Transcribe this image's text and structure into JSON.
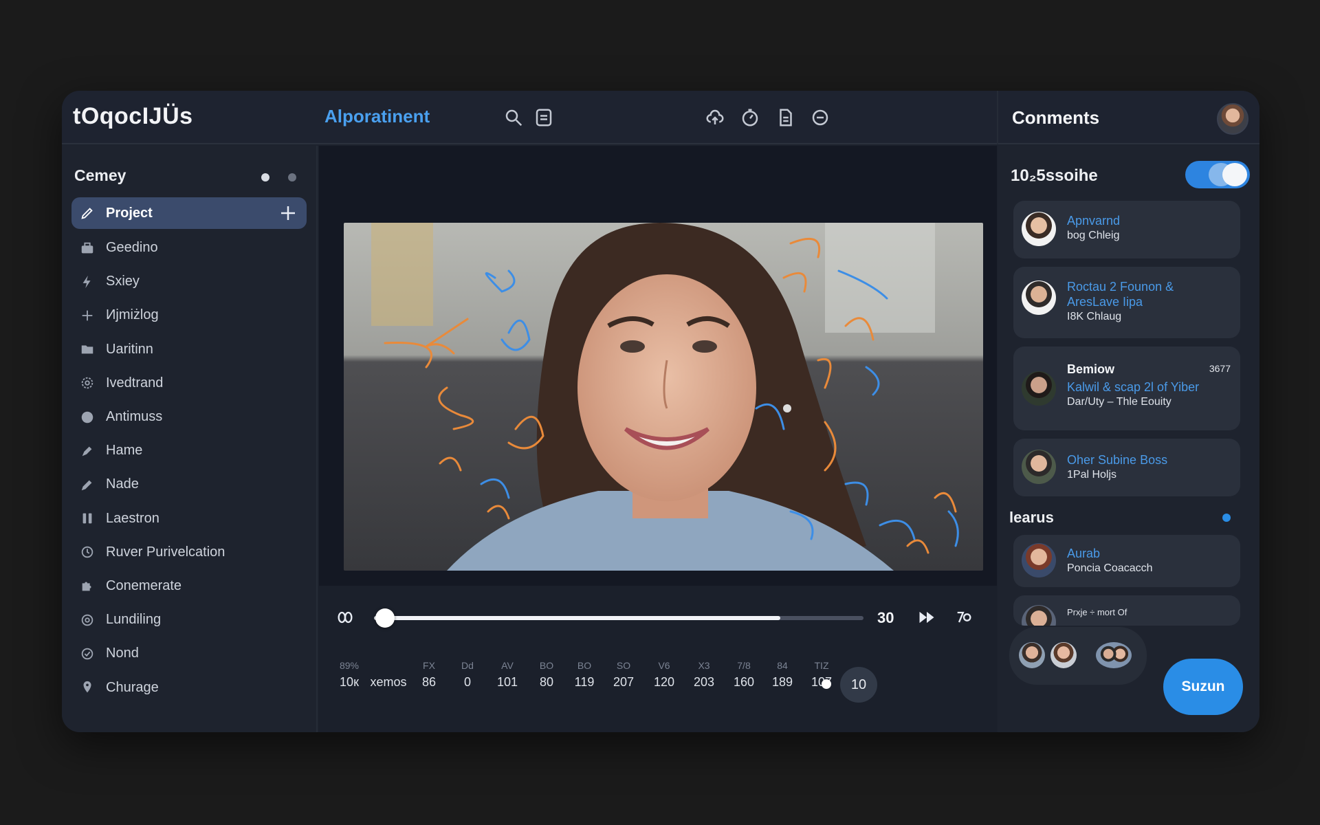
{
  "app": {
    "logo": "tOqocIJÜs",
    "document_title": "Alporatinent"
  },
  "header": {
    "icons": [
      "search-icon",
      "document-icon",
      "cloud-upload-icon",
      "timer-icon",
      "file-icon",
      "minus-circle-icon"
    ],
    "comments_title": "Conments"
  },
  "sidebar": {
    "heading": "Cemey",
    "items": [
      {
        "label": "Project",
        "icon": "pencil-icon",
        "active": true
      },
      {
        "label": "Geedino",
        "icon": "bag-icon"
      },
      {
        "label": "Sxiey",
        "icon": "lightning-icon"
      },
      {
        "label": "Ијmiżlog",
        "icon": "plus-icon"
      },
      {
        "label": "Uaritinn",
        "icon": "folder-icon"
      },
      {
        "label": "Ivedtrand",
        "icon": "cog-icon"
      },
      {
        "label": "Antimuss",
        "icon": "circle-icon"
      },
      {
        "label": "Hame",
        "icon": "pen-icon"
      },
      {
        "label": "Nade",
        "icon": "pencil-icon"
      },
      {
        "label": "Laestron",
        "icon": "pause-icon"
      },
      {
        "label": "Ruver Purivelcation",
        "icon": "clock-icon"
      },
      {
        "label": "Conemerate",
        "icon": "puzzle-icon"
      },
      {
        "label": "Lundiling",
        "icon": "refresh-icon"
      },
      {
        "label": "Nond",
        "icon": "check-circle-icon"
      },
      {
        "label": "Churage",
        "icon": "pin-icon"
      }
    ]
  },
  "timeline": {
    "progress": 0.83,
    "time": "30",
    "columns": [
      {
        "header": "89%",
        "value": "10к"
      },
      {
        "header": "",
        "value": "xemos"
      },
      {
        "header": "FX",
        "value": "86"
      },
      {
        "header": "Dd",
        "value": "0"
      },
      {
        "header": "AV",
        "value": "101"
      },
      {
        "header": "BO",
        "value": "80"
      },
      {
        "header": "BO",
        "value": "119"
      },
      {
        "header": "SO",
        "value": "207"
      },
      {
        "header": "V6",
        "value": "120"
      },
      {
        "header": "X3",
        "value": "203"
      },
      {
        "header": "7/8",
        "value": "160"
      },
      {
        "header": "84",
        "value": "189"
      },
      {
        "header": "TIZ",
        "value": "107"
      }
    ],
    "badge": "10"
  },
  "comments": {
    "subtitle": "10₂5ssoihe",
    "toggle_on": true,
    "cards": [
      {
        "line1": "Apnvarnd",
        "line2": "bog Chleig"
      },
      {
        "line1": "Roctau 2 Founon &",
        "line1b": "AresLave Iipa",
        "line2": "I8K Chlaug"
      },
      {
        "line1": "Bemiow",
        "num": "3677",
        "line1b": "Kalwil & scap 2l of Yiber",
        "line2": "Dar/Uty – Thle Eouity"
      },
      {
        "line1": "Oher Subine Boss",
        "line2": "1Pal Holjs"
      }
    ],
    "section_heading": "learus",
    "section_cards": [
      {
        "line1": "Aurab",
        "line2": "Poncia Coacacch"
      },
      {
        "line1": "Prxje ÷ mort Of",
        "line2": ""
      }
    ],
    "submit_label": "Suzun"
  },
  "colors": {
    "accent": "#2a8de6",
    "link": "#4a9ae8",
    "active_nav": "#3b4b6c"
  }
}
